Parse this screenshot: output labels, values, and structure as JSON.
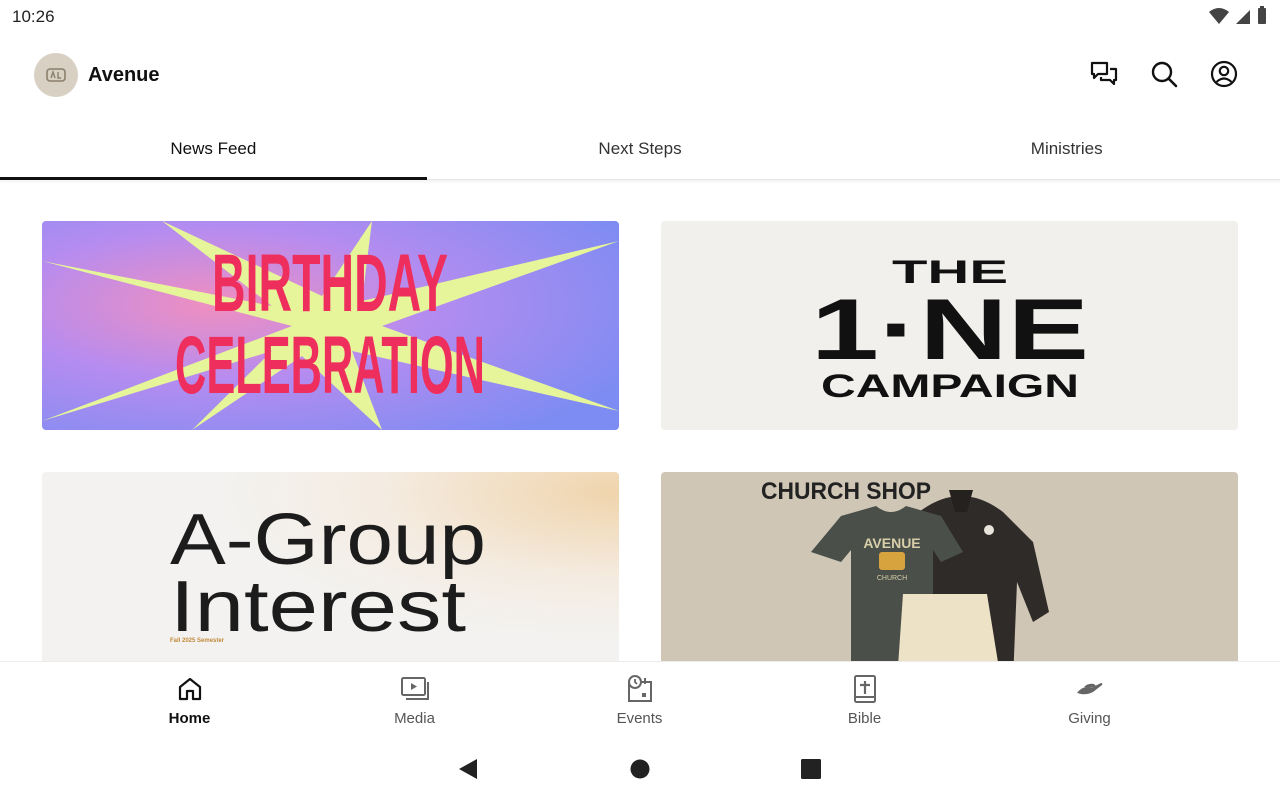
{
  "status_bar": {
    "time": "10:26"
  },
  "app_bar": {
    "title": "Avenue",
    "avatar_text": "AV"
  },
  "tabs": [
    {
      "label": "News Feed",
      "active": true
    },
    {
      "label": "Next Steps",
      "active": false
    },
    {
      "label": "Ministries",
      "active": false
    }
  ],
  "cards": [
    {
      "line1": "BIRTHDAY",
      "line2": "CELEBRATION"
    },
    {
      "line1": "THE",
      "line2": "1·NE",
      "line3": "CAMPAIGN"
    },
    {
      "line1": "A-Group",
      "line2": "Interest",
      "caption": "Fall 2025 Semester"
    },
    {
      "title": "CHURCH SHOP",
      "shirt_text": "AVENUE",
      "shirt_sub": "CHURCH"
    }
  ],
  "bottom_nav": [
    {
      "label": "Home",
      "icon": "home-icon",
      "active": true
    },
    {
      "label": "Media",
      "icon": "media-icon",
      "active": false
    },
    {
      "label": "Events",
      "icon": "events-icon",
      "active": false
    },
    {
      "label": "Bible",
      "icon": "bible-icon",
      "active": false
    },
    {
      "label": "Giving",
      "icon": "giving-icon",
      "active": false
    }
  ],
  "colors": {
    "accent": "#111111",
    "birthday_bg": "#9c8cf0",
    "birthday_text": "#ee2f5d",
    "birthday_burst": "#e6f59a",
    "one_bg": "#f1f0ed",
    "shop_bg": "#cfc6b6"
  }
}
